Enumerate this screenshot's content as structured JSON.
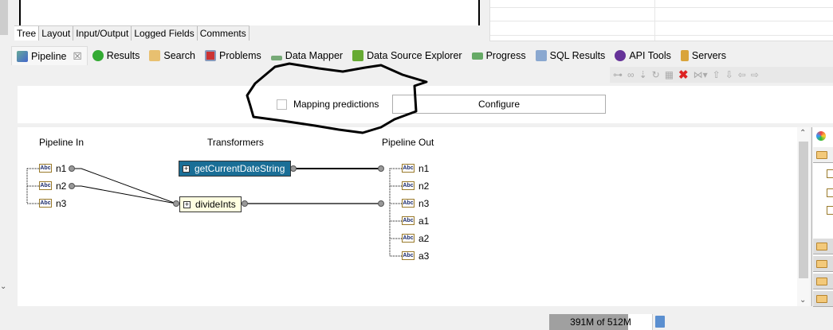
{
  "editor_tabs": [
    "Tree",
    "Layout",
    "Input/Output",
    "Logged Fields",
    "Comments"
  ],
  "view_tabs": [
    {
      "label": "Pipeline",
      "icon": "pipeline-icon",
      "active": true
    },
    {
      "label": "Results",
      "icon": "results-icon"
    },
    {
      "label": "Search",
      "icon": "search-icon"
    },
    {
      "label": "Problems",
      "icon": "problems-icon"
    },
    {
      "label": "Data Mapper",
      "icon": "data-mapper-icon"
    },
    {
      "label": "Data Source Explorer",
      "icon": "data-source-icon"
    },
    {
      "label": "Progress",
      "icon": "progress-icon"
    },
    {
      "label": "SQL Results",
      "icon": "sql-results-icon"
    },
    {
      "label": "API Tools",
      "icon": "api-tools-icon"
    },
    {
      "label": "Servers",
      "icon": "servers-icon"
    }
  ],
  "close_glyph": "☒",
  "options": {
    "mapping_predictions": "Mapping predictions",
    "mapping_predictions_checked": false,
    "configure": "Configure"
  },
  "mapper": {
    "in_header": "Pipeline In",
    "transformers_header": "Transformers",
    "out_header": "Pipeline Out",
    "in_fields": [
      "n1",
      "n2",
      "n3"
    ],
    "transformers": [
      "getCurrentDateString",
      "divideInts"
    ],
    "out_fields": [
      "n1",
      "n2",
      "n3",
      "a1",
      "a2",
      "a3"
    ],
    "field_type": "Abc"
  },
  "status": {
    "memory": "391M of 512M",
    "memory_used_fraction": 0.764
  },
  "colors": {
    "selected_transformer": "#1a6e96",
    "transformer": "#ffffe1"
  }
}
